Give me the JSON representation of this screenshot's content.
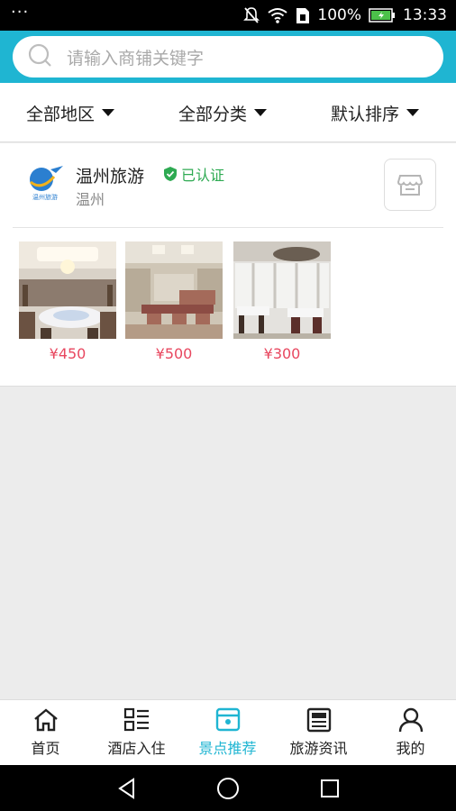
{
  "status_bar": {
    "battery": "100%",
    "time": "13:33",
    "icons": [
      "overflow-dots-icon",
      "mute-icon",
      "wifi-icon",
      "sim-icon",
      "battery-icon"
    ]
  },
  "search": {
    "placeholder": "请输入商铺关键字",
    "icon": "search-icon"
  },
  "filters": [
    {
      "label": "全部地区"
    },
    {
      "label": "全部分类"
    },
    {
      "label": "默认排序"
    }
  ],
  "shop": {
    "name": "温州旅游",
    "badge": "已认证",
    "city": "温州",
    "logo_text": "温州旅游",
    "store_icon": "store-icon",
    "accent": "#2eaa52",
    "products": [
      {
        "price": "¥450"
      },
      {
        "price": "¥500"
      },
      {
        "price": "¥300"
      }
    ]
  },
  "bottom_nav": [
    {
      "label": "首页",
      "icon": "home-icon"
    },
    {
      "label": "酒店入住",
      "icon": "list-icon"
    },
    {
      "label": "景点推荐",
      "icon": "shop-icon",
      "active": true
    },
    {
      "label": "旅游资讯",
      "icon": "news-icon"
    },
    {
      "label": "我的",
      "icon": "user-icon"
    }
  ],
  "colors": {
    "brand": "#1fb5d2",
    "price": "#e8475f",
    "verified": "#2eaa52"
  }
}
